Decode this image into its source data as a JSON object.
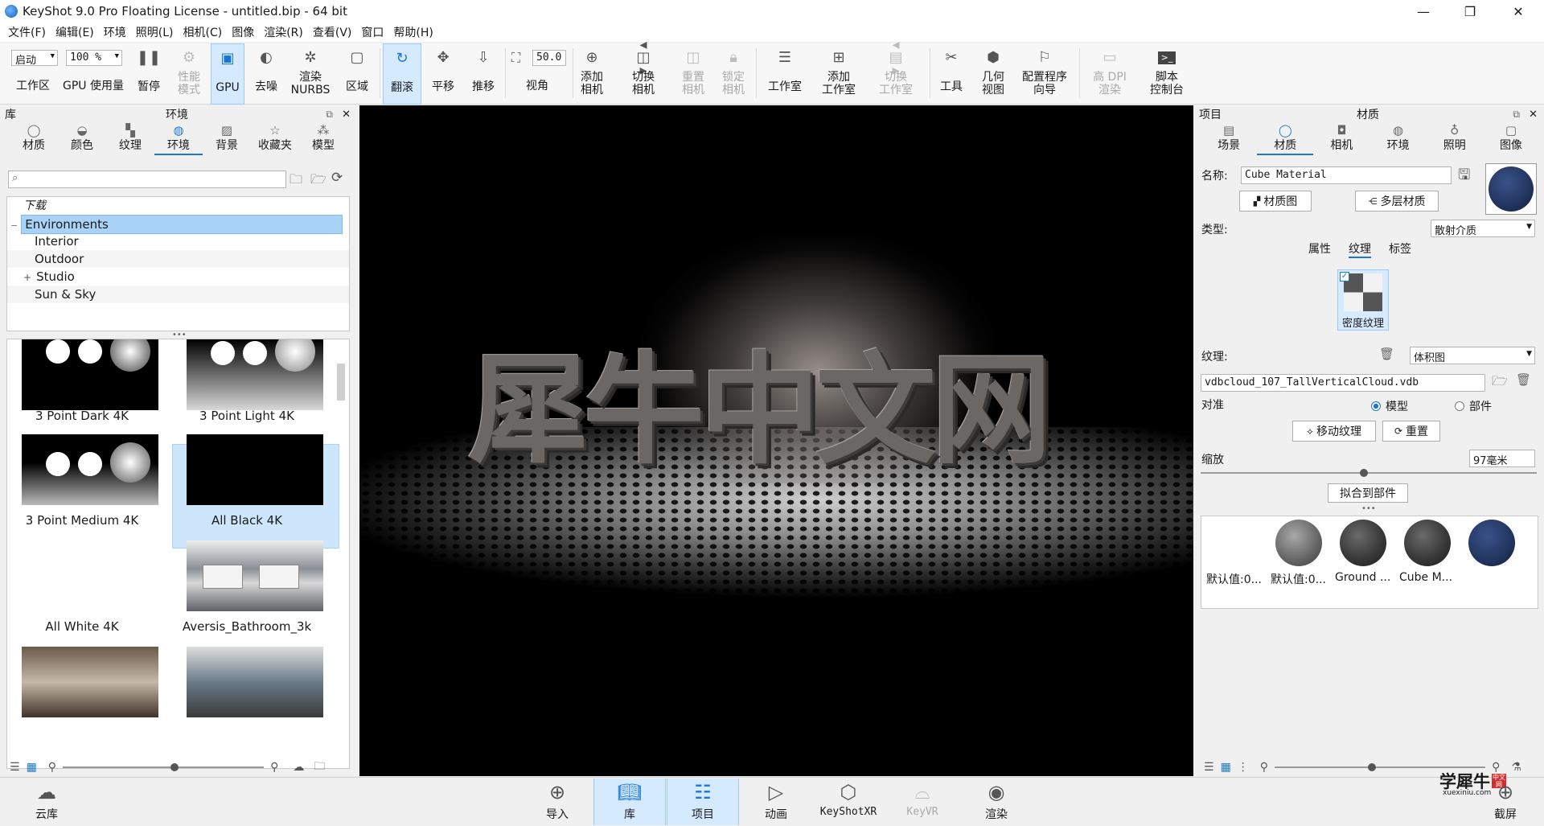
{
  "window": {
    "title": "KeyShot 9.0 Pro Floating License  -  untitled.bip  -  64 bit"
  },
  "menu": [
    "文件(F)",
    "编辑(E)",
    "环境",
    "照明(L)",
    "相机(C)",
    "图像",
    "渲染(R)",
    "查看(V)",
    "窗口",
    "帮助(H)"
  ],
  "toolbar": {
    "workspace_value": "启动",
    "workspace_label": "工作区",
    "cpu_value": "100 %",
    "gpu_usage_label": "GPU  使用量",
    "pause": "暂停",
    "perf_mode": [
      "性能",
      "模式"
    ],
    "gpu": "GPU",
    "denoise": "去噪",
    "render_nurbs": [
      "渲染",
      "NURBS"
    ],
    "region": "区域",
    "tumble": "翻滚",
    "pan": "平移",
    "dolly": "推移",
    "fov_value": "50.0",
    "fov_label": "视角",
    "add_camera": [
      "添加",
      "相机"
    ],
    "switch_camera": [
      "切换",
      "相机"
    ],
    "reset_camera": [
      "重置",
      "相机"
    ],
    "lock_camera": [
      "锁定",
      "相机"
    ],
    "studio": "工作室",
    "add_studio": [
      "添加",
      "工作室"
    ],
    "switch_studio": [
      "切换",
      "工作室"
    ],
    "tools": "工具",
    "geometry_view": [
      "几何",
      "视图"
    ],
    "config_wizard": [
      "配置程序",
      "向导"
    ],
    "high_dpi": [
      "高 DPI",
      "渲染"
    ],
    "script_console": [
      "脚本",
      "控制台"
    ]
  },
  "library": {
    "panel_title": "库",
    "section_title": "环境",
    "tabs": [
      "材质",
      "颜色",
      "纹理",
      "环境",
      "背景",
      "收藏夹",
      "模型"
    ],
    "selected_tab": "环境",
    "search_placeholder": "",
    "tree": [
      "下载",
      "Environments",
      "Interior",
      "Outdoor",
      "Studio",
      "Sun & Sky"
    ],
    "tree_selected": "Environments",
    "thumbnails": [
      "3 Point Dark 4K",
      "3 Point Light 4K",
      "3 Point Medium 4K",
      "All Black 4K",
      "All White 4K",
      "Aversis_Bathroom_3k"
    ],
    "thumbnail_selected": "All Black 4K"
  },
  "viewport": {
    "watermark_text": "犀牛中文网"
  },
  "project": {
    "panel_title": "项目",
    "section_title": "材质",
    "tabs": [
      "场景",
      "材质",
      "相机",
      "环境",
      "照明",
      "图像"
    ],
    "selected_tab": "材质",
    "name_label": "名称:",
    "name_value": "Cube Material",
    "material_graph": "材质图",
    "multi_material": "多层材质",
    "type_label": "类型:",
    "type_value": "散射介质",
    "subtabs": [
      "属性",
      "纹理",
      "标签"
    ],
    "selected_subtab": "纹理",
    "density_texture": "密度纹理",
    "texture_label": "纹理:",
    "texture_type": "体积图",
    "texture_file": "vdbcloud_107_TallVerticalCloud.vdb",
    "align_label": "对准",
    "align_options": [
      "模型",
      "部件"
    ],
    "align_selected": "模型",
    "move_texture": "移动纹理",
    "reset": "重置",
    "scale_label": "缩放",
    "scale_value": "97毫米",
    "fit_to_part": "拟合到部件",
    "materials": [
      "默认值:0...",
      "默认值:0...",
      "Ground ...",
      "Cube M..."
    ]
  },
  "bottom": {
    "cloud_library": "云库",
    "import": "导入",
    "library": "库",
    "project": "项目",
    "animation": "动画",
    "keyshotxr": "KeyShotXR",
    "keyvr": "KeyVR",
    "render": "渲染",
    "screenshot": "截屏",
    "watermark_main": "学犀牛",
    "watermark_sub": "xuexiniu.com",
    "watermark_badge": "中文网"
  },
  "colors": {
    "accent": "#1976d2",
    "cube_material": "#22355f",
    "selection": "#a9d2f7"
  }
}
